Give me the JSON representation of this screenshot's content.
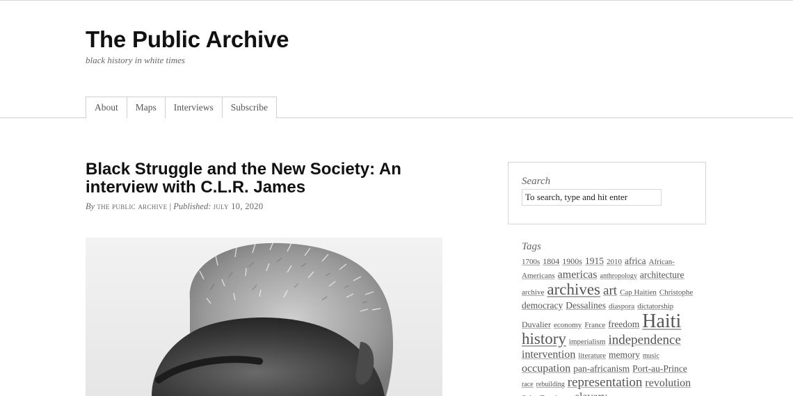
{
  "site": {
    "title": "The Public Archive",
    "tagline": "black history in white times"
  },
  "nav": [
    "About",
    "Maps",
    "Interviews",
    "Subscribe"
  ],
  "post": {
    "title": "Black Struggle and the New Society: An interview with C.L.R. James",
    "by_label": "By",
    "author": "The Public Archive",
    "separator": "|",
    "published_label": "Published:",
    "date": "July 10, 2020"
  },
  "sidebar": {
    "search": {
      "label": "Search",
      "placeholder": "To search, type and hit enter"
    },
    "tags_title": "Tags",
    "tags": [
      {
        "label": "1700s",
        "size": 1
      },
      {
        "label": "1804",
        "size": 2
      },
      {
        "label": "1900s",
        "size": 2
      },
      {
        "label": "1915",
        "size": 3
      },
      {
        "label": "2010",
        "size": 1
      },
      {
        "label": "africa",
        "size": 3
      },
      {
        "label": "African-Americans",
        "size": 1
      },
      {
        "label": "americas",
        "size": 4
      },
      {
        "label": "anthropology",
        "size": 0
      },
      {
        "label": "architecture",
        "size": 3
      },
      {
        "label": "archive",
        "size": 1
      },
      {
        "label": "archives",
        "size": 6
      },
      {
        "label": "art",
        "size": 5
      },
      {
        "label": "Cap Haitien",
        "size": 1
      },
      {
        "label": "Christophe",
        "size": 1
      },
      {
        "label": "democracy",
        "size": 3
      },
      {
        "label": "Dessalines",
        "size": 3
      },
      {
        "label": "diaspora",
        "size": 1
      },
      {
        "label": "dictatorship",
        "size": 1
      },
      {
        "label": "Duvalier",
        "size": 2
      },
      {
        "label": "economy",
        "size": 1
      },
      {
        "label": "France",
        "size": 1
      },
      {
        "label": "freedom",
        "size": 3
      },
      {
        "label": "Haiti",
        "size": 7
      },
      {
        "label": "history",
        "size": 6
      },
      {
        "label": "imperialism",
        "size": 1
      },
      {
        "label": "independence",
        "size": 5
      },
      {
        "label": "intervention",
        "size": 4
      },
      {
        "label": "literature",
        "size": 1
      },
      {
        "label": "memory",
        "size": 3
      },
      {
        "label": "music",
        "size": 0
      },
      {
        "label": "occupation",
        "size": 4
      },
      {
        "label": "pan-africanism",
        "size": 3
      },
      {
        "label": "Port-au-Prince",
        "size": 3
      },
      {
        "label": "race",
        "size": 0
      },
      {
        "label": "rebuilding",
        "size": 0
      },
      {
        "label": "representation",
        "size": 5
      },
      {
        "label": "revolution",
        "size": 4
      },
      {
        "label": "Saint-Domingue",
        "size": 1
      },
      {
        "label": "slavery",
        "size": 4
      }
    ]
  },
  "colors": {
    "text": "#111111",
    "muted": "#666666",
    "border": "#d6d6d6",
    "link": "#555555"
  }
}
